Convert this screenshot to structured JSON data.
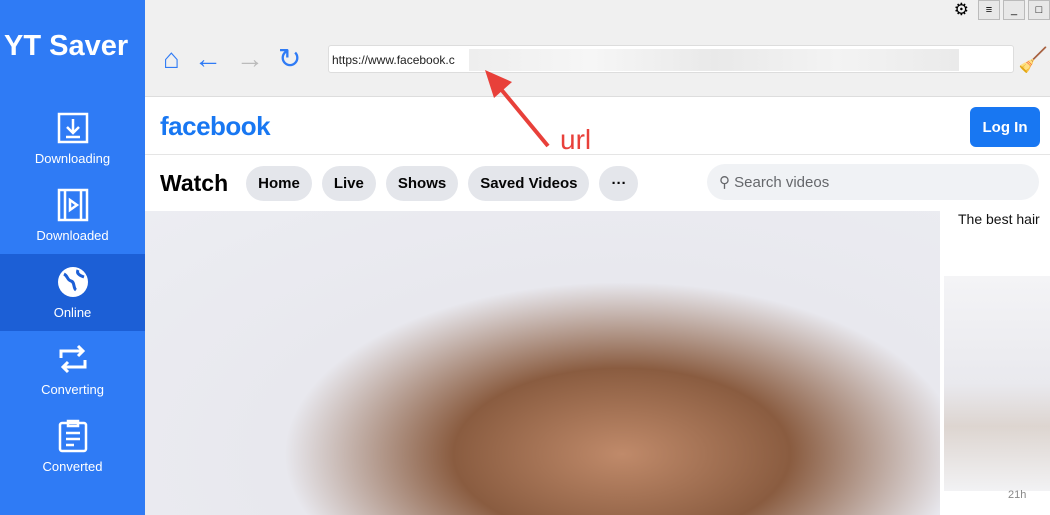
{
  "app": {
    "title": "YT Saver"
  },
  "sidebar": {
    "items": [
      {
        "label": "Downloading",
        "icon": "download-icon"
      },
      {
        "label": "Downloaded",
        "icon": "film-icon"
      },
      {
        "label": "Online",
        "icon": "globe-icon",
        "active": true
      },
      {
        "label": "Converting",
        "icon": "convert-icon"
      },
      {
        "label": "Converted",
        "icon": "document-icon"
      }
    ]
  },
  "toolbar": {
    "url": "https://www.facebook.c"
  },
  "facebook": {
    "logo": "facebook",
    "login": "Log In",
    "watch": "Watch",
    "tabs": [
      "Home",
      "Live",
      "Shows",
      "Saved Videos",
      "···"
    ],
    "search_placeholder": "Search videos",
    "side_title": "The best hair",
    "side_time": "21h"
  },
  "annotation": {
    "label": "url",
    "color": "#e8403a"
  },
  "colors": {
    "sidebar": "#2f7bf5",
    "active": "#1c5fd6",
    "fb_blue": "#1877f2"
  }
}
